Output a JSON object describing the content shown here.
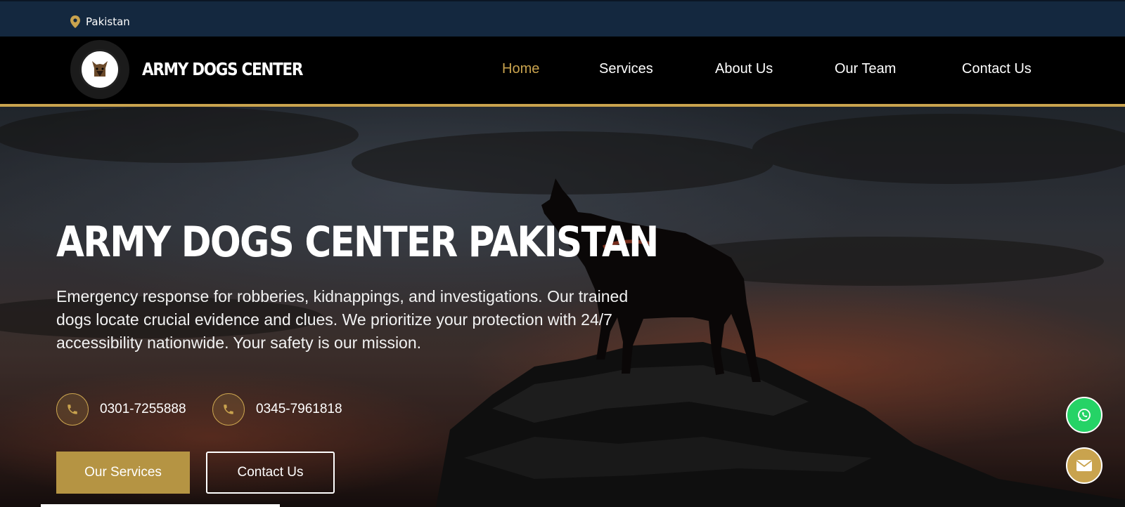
{
  "topbar": {
    "location": "Pakistan",
    "icon": "map-pin-icon"
  },
  "navbar": {
    "brand": "ARMY DOGS CENTER",
    "logo_text": "ARMY DOGS CENTER",
    "items": [
      {
        "label": "Home",
        "active": true
      },
      {
        "label": "Services"
      },
      {
        "label": "About Us"
      },
      {
        "label": "Our Team"
      },
      {
        "label": "Contact Us"
      }
    ]
  },
  "hero": {
    "title": "ARMY DOGS CENTER PAKISTAN",
    "description": "Emergency response for robberies, kidnappings, and investigations. Our trained dogs locate crucial evidence and clues. We prioritize your protection with 24/7 accessibility nationwide. Your safety is our mission.",
    "phones": [
      "0301-7255888",
      "0345-7961818"
    ],
    "primary_button": "Our Services",
    "secondary_button": "Contact Us"
  },
  "floating": {
    "whatsapp_icon": "whatsapp-icon",
    "mail_icon": "mail-icon"
  },
  "colors": {
    "accent": "#c9a34e",
    "topbar": "#14283f",
    "whatsapp": "#25d366"
  }
}
